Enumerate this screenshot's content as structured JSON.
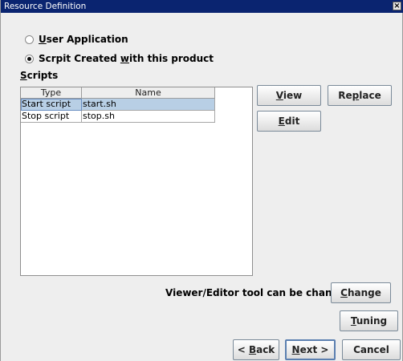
{
  "window": {
    "title": "Resource Definition",
    "close_glyph": "×"
  },
  "options": {
    "user_application": {
      "prefix": "",
      "mnemonic": "U",
      "rest": "ser Application",
      "selected": false
    },
    "script_created": {
      "prefix": "Scrpit Created ",
      "mnemonic": "w",
      "rest": "ith this product",
      "selected": true
    }
  },
  "scripts": {
    "label_mnemonic": "S",
    "label_rest": "cripts",
    "columns": [
      "Type",
      "Name"
    ],
    "rows": [
      {
        "type": "Start script",
        "name": "start.sh",
        "selected": true
      },
      {
        "type": "Stop script",
        "name": "stop.sh",
        "selected": false
      }
    ]
  },
  "buttons": {
    "view": {
      "mnemonic": "V",
      "rest": "iew"
    },
    "replace": {
      "prefix": "Re",
      "mnemonic": "p",
      "rest": "lace"
    },
    "edit": {
      "mnemonic": "E",
      "rest": "dit"
    },
    "change": {
      "mnemonic": "C",
      "rest": "hange"
    },
    "tuning": {
      "mnemonic": "T",
      "rest": "uning"
    },
    "back": {
      "prefix": "< ",
      "mnemonic": "B",
      "rest": "ack"
    },
    "next": {
      "mnemonic": "N",
      "rest": "ext >"
    },
    "cancel": {
      "label": "Cancel"
    }
  },
  "viewer_note": "Viewer/Editor tool can be changed"
}
